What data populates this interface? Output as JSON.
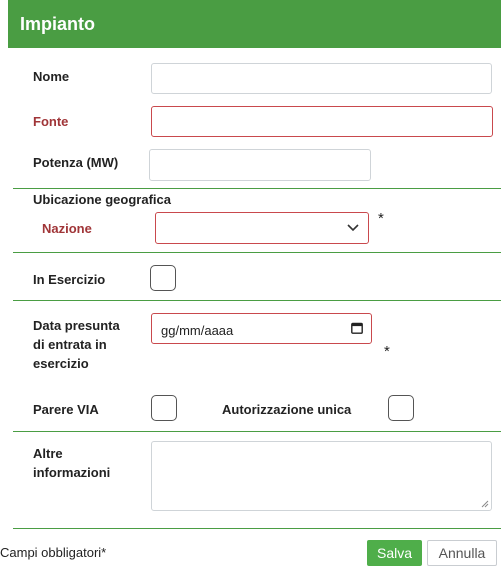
{
  "header": {
    "title": "Impianto"
  },
  "form": {
    "nome_label": "Nome",
    "fonte_label": "Fonte",
    "potenza_label": "Potenza (MW)",
    "ubicazione_label": "Ubicazione geografica",
    "nazione_label": "Nazione",
    "nazione_required": "*",
    "in_esercizio_label": "In Esercizio",
    "data_label_line1": "Data presunta",
    "data_label_line2": "di entrata in",
    "data_label_line3": "esercizio",
    "data_placeholder": "gg/mm/aaaa",
    "data_required": "*",
    "parere_via_label": "Parere VIA",
    "autorizzazione_label": "Autorizzazione unica",
    "altre_label_line1": "Altre",
    "altre_label_line2": "informazioni"
  },
  "footer": {
    "required_note": "Campi obbligatori*",
    "save_label": "Salva",
    "cancel_label": "Annulla"
  },
  "colors": {
    "accent": "#4a9d43",
    "required": "#a03538",
    "error_border": "#c9494d"
  }
}
